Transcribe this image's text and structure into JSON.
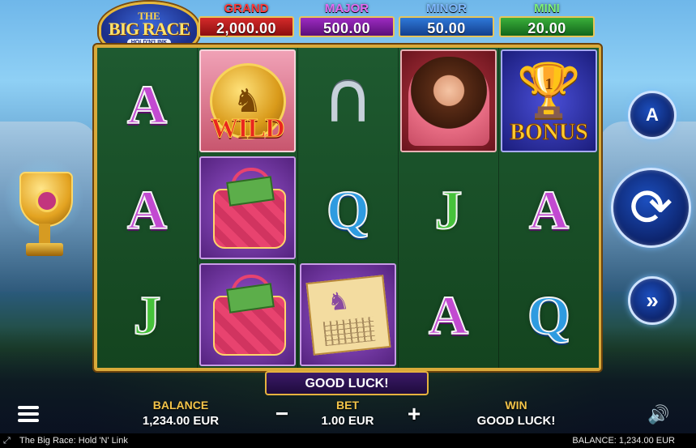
{
  "logo": {
    "line1": "THE",
    "line2": "BIG RACE",
    "line3": "HOLD'N'LINK"
  },
  "jackpots": [
    {
      "name": "GRAND",
      "value": "2,000.00"
    },
    {
      "name": "MAJOR",
      "value": "500.00"
    },
    {
      "name": "MINOR",
      "value": "50.00"
    },
    {
      "name": "MINI",
      "value": "20.00"
    }
  ],
  "reels": {
    "symbols": [
      [
        "A",
        "A",
        "J"
      ],
      [
        "WILD",
        "handbag",
        "handbag"
      ],
      [
        "horseshoe",
        "Q",
        "race-program"
      ],
      [
        "lady",
        "J",
        "A"
      ],
      [
        "BONUS",
        "A",
        "Q"
      ]
    ],
    "wild_text": "WILD",
    "bonus_text": "BONUS",
    "bonus_cup_number": "1"
  },
  "banner": {
    "text": "GOOD LUCK!"
  },
  "hud": {
    "balance_label": "BALANCE",
    "balance_value": "1,234.00 EUR",
    "bet_label": "BET",
    "bet_value": "1.00 EUR",
    "win_label": "WIN",
    "win_value": "GOOD LUCK!"
  },
  "controls": {
    "autoplay_letter": "A",
    "icons": [
      "menu-icon",
      "minus-icon",
      "plus-icon",
      "speaker-icon",
      "autoplay-icon",
      "spin-icon",
      "turbo-icon",
      "expand-icon"
    ]
  },
  "statusbar": {
    "title": "The Big Race: Hold 'N' Link",
    "balance": "BALANCE: 1,234.00 EUR"
  }
}
